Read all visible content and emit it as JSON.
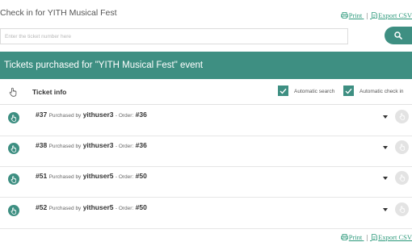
{
  "page": {
    "title": "Check in for YITH Musical Fest",
    "print_label": "Print",
    "separator": "|",
    "export_label": "Export CSV"
  },
  "search": {
    "placeholder": "Enter the ticket number here",
    "button_icon": "search-icon"
  },
  "banner": {
    "text": "Tickets purchased for \"YITH Musical Fest\" event"
  },
  "table": {
    "header_icon": "hand-pointer-icon",
    "column_title": "Ticket info",
    "automatic_search_label": "Automatic search",
    "automatic_search_checked": true,
    "automatic_checkin_label": "Automatic check in",
    "automatic_checkin_checked": true
  },
  "tickets": [
    {
      "number": "#37",
      "purchased_by": "Purchased by",
      "user": "yithuser3",
      "order_label": "- Order:",
      "order": "#36"
    },
    {
      "number": "#38",
      "purchased_by": "Purchased by",
      "user": "yithuser3",
      "order_label": "- Order:",
      "order": "#36"
    },
    {
      "number": "#51",
      "purchased_by": "Purchased by",
      "user": "yithuser5",
      "order_label": "- Order:",
      "order": "#50"
    },
    {
      "number": "#52",
      "purchased_by": "Purchased by",
      "user": "yithuser5",
      "order_label": "- Order:",
      "order": "#50"
    }
  ],
  "colors": {
    "accent": "#3e8f82",
    "link": "#2e9a7c",
    "disabled_button": "#e3e3e3"
  }
}
